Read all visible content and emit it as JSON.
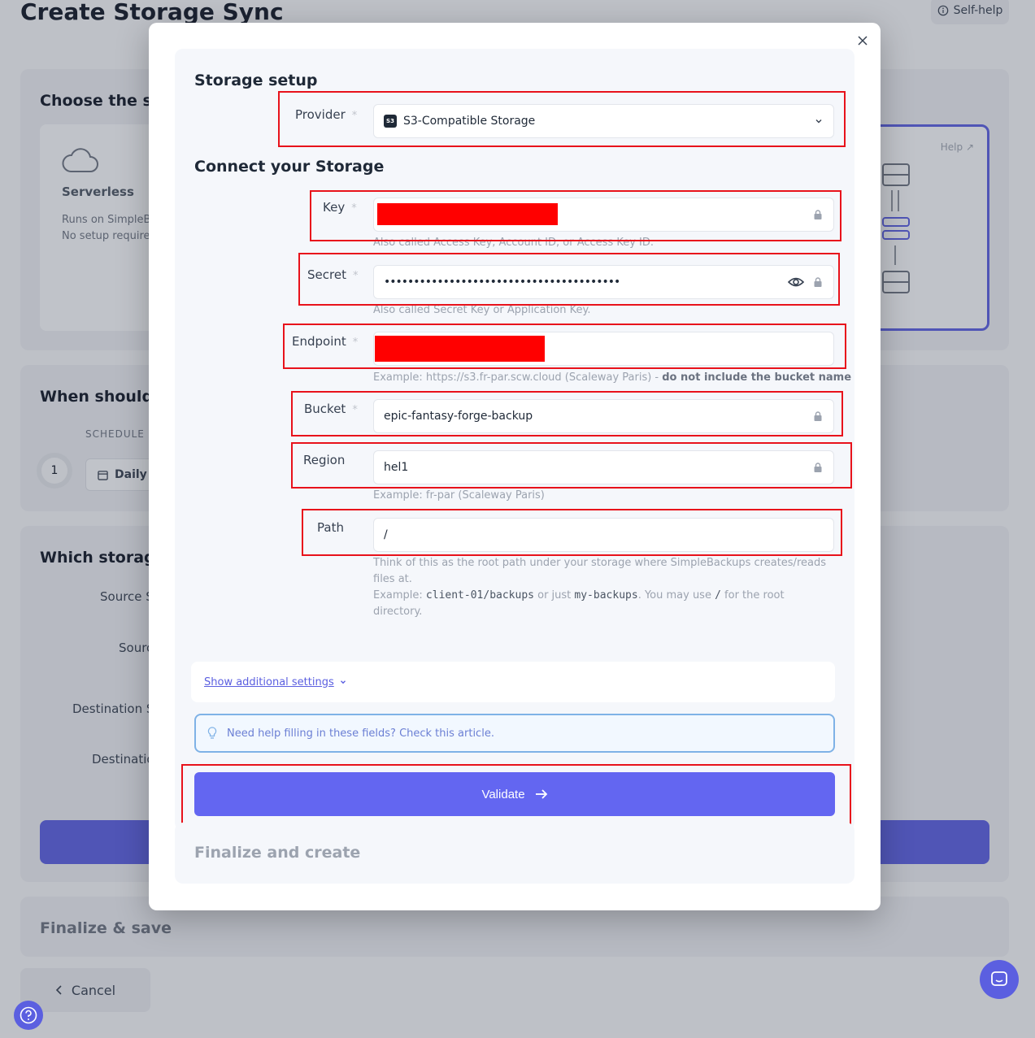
{
  "background": {
    "title": "Create Storage Sync",
    "self_help": "Self-help",
    "card1_title": "Choose the ser",
    "serverless_title": "Serverless",
    "serverless_line1": "Runs on SimpleB",
    "serverless_line2": "No setup require",
    "help_link": "Help",
    "card2_title": "When should w",
    "schedule_label": "SCHEDULE",
    "step_number": "1",
    "daily_label": "Daily",
    "card3_title": "Which storage",
    "source_storage_label": "Source S",
    "source_label": "Sourc",
    "destination_storage_label": "Destination S",
    "destination_label": "Destinatio",
    "finalize_save": "Finalize & save",
    "cancel": "Cancel"
  },
  "modal": {
    "storage_setup_title": "Storage setup",
    "provider": {
      "label": "Provider",
      "required": "*",
      "value": "S3-Compatible Storage",
      "icon_text": "S3"
    },
    "connect_title": "Connect your Storage",
    "key": {
      "label": "Key",
      "required": "*",
      "value": "",
      "hint": "Also called Access Key, Account ID, or Access Key ID."
    },
    "secret": {
      "label": "Secret",
      "required": "*",
      "value": "••••••••••••••••••••••••••••••••••••••••",
      "hint": "Also called Secret Key or Application Key."
    },
    "endpoint": {
      "label": "Endpoint",
      "required": "*",
      "value": "",
      "hint_prefix": "Example: https://s3.fr-par.scw.cloud (Scaleway Paris) - ",
      "hint_bold": "do not include the bucket name"
    },
    "bucket": {
      "label": "Bucket",
      "required": "*",
      "value": "epic-fantasy-forge-backup"
    },
    "region": {
      "label": "Region",
      "value": "hel1",
      "hint": "Example: fr-par (Scaleway Paris)"
    },
    "path": {
      "label": "Path",
      "value": "/",
      "hint_line1": "Think of this as the root path under your storage where SimpleBackups creates/reads",
      "hint_line2": "files at.",
      "hint_ex_prefix": "Example: ",
      "hint_ex_code1": "client-01/backups",
      "hint_ex_mid": " or just ",
      "hint_ex_code2": "my-backups",
      "hint_ex_mid2": ". You may use ",
      "hint_ex_code3": "/",
      "hint_ex_suffix": " for the root",
      "hint_line4": "directory."
    },
    "show_additional": "Show additional settings",
    "help_text": "Need help filling in these fields? Check this article.",
    "validate_label": "Validate",
    "finalize_title": "Finalize and create"
  },
  "colors": {
    "accent": "#6366f1",
    "highlight": "#e8121b",
    "redaction": "#ff0000"
  }
}
